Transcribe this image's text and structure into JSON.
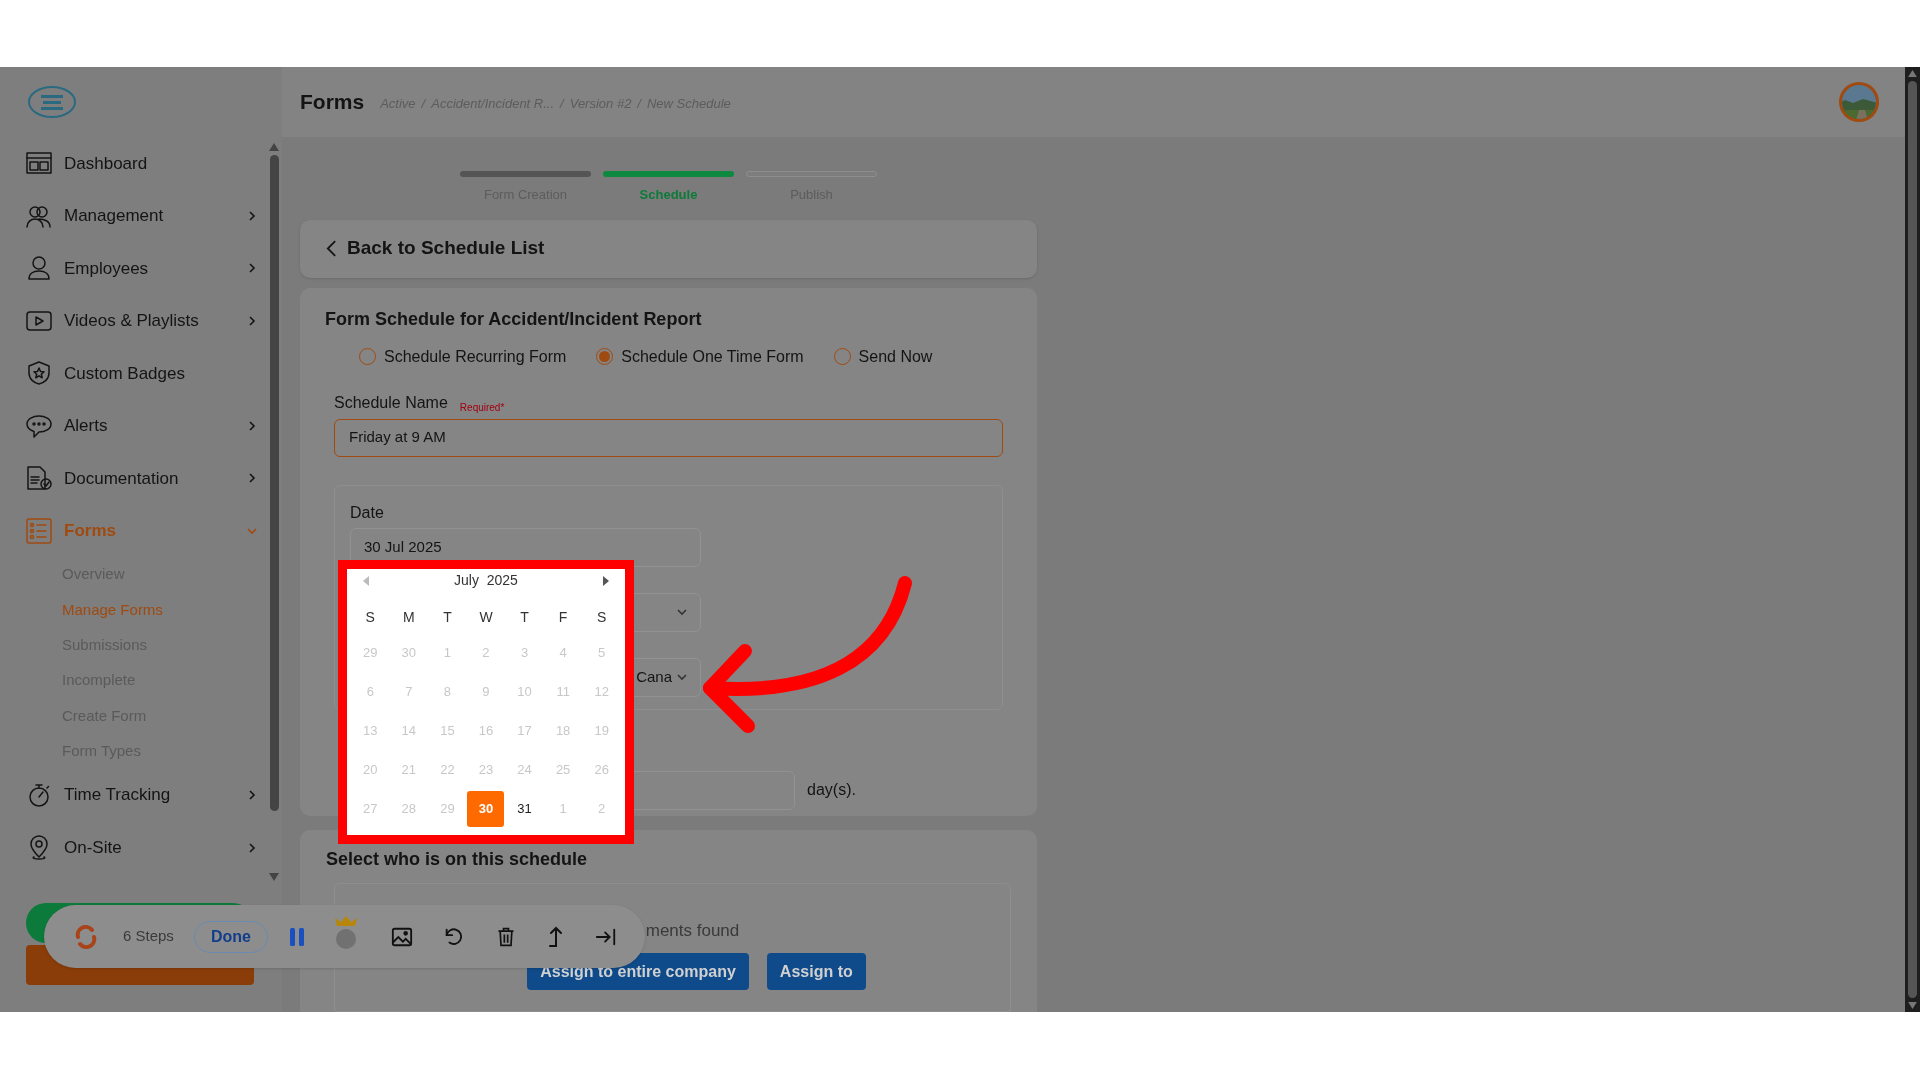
{
  "sidebar": {
    "items": [
      {
        "label": "Dashboard",
        "expandable": false,
        "selected": false
      },
      {
        "label": "Management",
        "expandable": true,
        "expanded": false,
        "selected": false
      },
      {
        "label": "Employees",
        "expandable": true,
        "expanded": false,
        "selected": false
      },
      {
        "label": "Videos & Playlists",
        "expandable": true,
        "expanded": false,
        "selected": false
      },
      {
        "label": "Custom Badges",
        "expandable": false,
        "selected": false
      },
      {
        "label": "Alerts",
        "expandable": true,
        "expanded": false,
        "selected": false
      },
      {
        "label": "Documentation",
        "expandable": true,
        "expanded": false,
        "selected": false
      },
      {
        "label": "Forms",
        "expandable": true,
        "expanded": true,
        "selected": true,
        "children": [
          {
            "label": "Overview",
            "selected": false
          },
          {
            "label": "Manage Forms",
            "selected": true
          },
          {
            "label": "Submissions",
            "selected": false
          },
          {
            "label": "Incomplete",
            "selected": false
          },
          {
            "label": "Create Form",
            "selected": false
          },
          {
            "label": "Form Types",
            "selected": false
          }
        ]
      },
      {
        "label": "Time Tracking",
        "expandable": true,
        "expanded": false,
        "selected": false
      },
      {
        "label": "On-Site",
        "expandable": true,
        "expanded": false,
        "selected": false
      }
    ]
  },
  "header": {
    "title": "Forms",
    "breadcrumbs": [
      "Active",
      "/",
      "Accident/Incident R...",
      "/",
      "Version #2",
      "/",
      "New Schedule"
    ]
  },
  "steps": [
    {
      "label": "Form Creation",
      "completed": true,
      "selected": false
    },
    {
      "label": "Schedule",
      "completed": false,
      "selected": true
    },
    {
      "label": "Publish",
      "completed": false,
      "selected": false
    }
  ],
  "back_link": "Back to Schedule List",
  "schedule_form": {
    "title": "Form Schedule for Accident/Incident Report",
    "options": [
      {
        "label": "Schedule Recurring Form",
        "selected": false
      },
      {
        "label": "Schedule One Time Form",
        "selected": true
      },
      {
        "label": "Send Now",
        "selected": false
      }
    ],
    "name_label": "Schedule Name",
    "required": "Required*",
    "name_value": "Friday at 9 AM",
    "date_label": "Date",
    "date_value": "30 Jul 2025",
    "timezone_value": "Cana",
    "days_suffix": "day(s)."
  },
  "calendar": {
    "month": "July",
    "year": "2025",
    "weekdays": [
      "S",
      "M",
      "T",
      "W",
      "T",
      "F",
      "S"
    ],
    "days": [
      {
        "label": "29",
        "disabled": true,
        "selected": false
      },
      {
        "label": "30",
        "disabled": true,
        "selected": false
      },
      {
        "label": "1",
        "disabled": true,
        "selected": false
      },
      {
        "label": "2",
        "disabled": true,
        "selected": false
      },
      {
        "label": "3",
        "disabled": true,
        "selected": false
      },
      {
        "label": "4",
        "disabled": true,
        "selected": false
      },
      {
        "label": "5",
        "disabled": true,
        "selected": false
      },
      {
        "label": "6",
        "disabled": true,
        "selected": false
      },
      {
        "label": "7",
        "disabled": true,
        "selected": false
      },
      {
        "label": "8",
        "disabled": true,
        "selected": false
      },
      {
        "label": "9",
        "disabled": true,
        "selected": false
      },
      {
        "label": "10",
        "disabled": true,
        "selected": false
      },
      {
        "label": "11",
        "disabled": true,
        "selected": false
      },
      {
        "label": "12",
        "disabled": true,
        "selected": false
      },
      {
        "label": "13",
        "disabled": true,
        "selected": false
      },
      {
        "label": "14",
        "disabled": true,
        "selected": false
      },
      {
        "label": "15",
        "disabled": true,
        "selected": false
      },
      {
        "label": "16",
        "disabled": true,
        "selected": false
      },
      {
        "label": "17",
        "disabled": true,
        "selected": false
      },
      {
        "label": "18",
        "disabled": true,
        "selected": false
      },
      {
        "label": "19",
        "disabled": true,
        "selected": false
      },
      {
        "label": "20",
        "disabled": true,
        "selected": false
      },
      {
        "label": "21",
        "disabled": true,
        "selected": false
      },
      {
        "label": "22",
        "disabled": true,
        "selected": false
      },
      {
        "label": "23",
        "disabled": true,
        "selected": false
      },
      {
        "label": "24",
        "disabled": true,
        "selected": false
      },
      {
        "label": "25",
        "disabled": true,
        "selected": false
      },
      {
        "label": "26",
        "disabled": true,
        "selected": false
      },
      {
        "label": "27",
        "disabled": true,
        "selected": false
      },
      {
        "label": "28",
        "disabled": true,
        "selected": false
      },
      {
        "label": "29",
        "disabled": true,
        "selected": false
      },
      {
        "label": "30",
        "disabled": false,
        "selected": true
      },
      {
        "label": "31",
        "disabled": false,
        "selected": false
      },
      {
        "label": "1",
        "disabled": true,
        "selected": false
      },
      {
        "label": "2",
        "disabled": true,
        "selected": false
      }
    ]
  },
  "assign": {
    "title": "Select who is on this schedule",
    "empty_text": "ments found",
    "buttons": [
      "Assign to entire company",
      "Assign to"
    ]
  },
  "recorder": {
    "steps": "6 Steps",
    "done": "Done"
  }
}
